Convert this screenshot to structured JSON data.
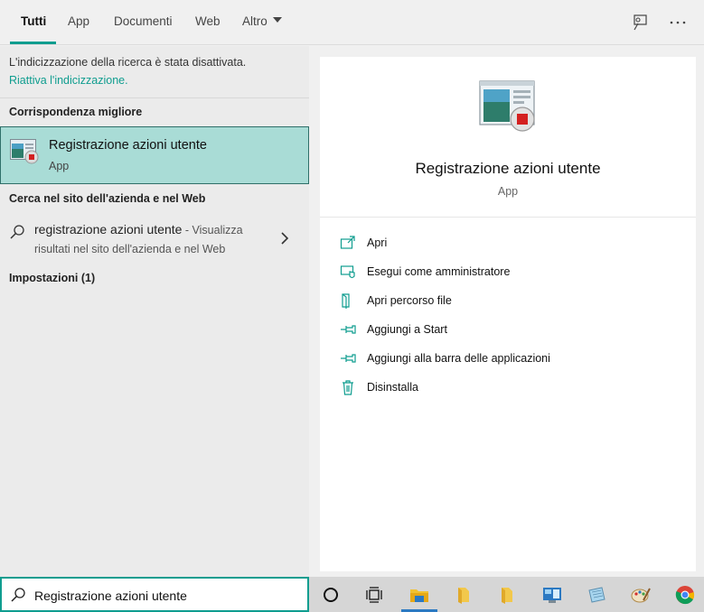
{
  "tabs": [
    {
      "label": "Tutti"
    },
    {
      "label": "App"
    },
    {
      "label": "Documenti"
    },
    {
      "label": "Web"
    },
    {
      "label": "Altro"
    }
  ],
  "top_icons": {
    "feedback": "feedback-icon",
    "more": "more-options-icon"
  },
  "left": {
    "notice": "L'indicizzazione della ricerca è stata disattivata.",
    "notice_link": "Riattiva l'indicizzazione.",
    "best_match_header": "Corrispondenza migliore",
    "best_match": {
      "title": "Registrazione azioni utente",
      "subtitle": "App"
    },
    "web_header": "Cerca nel sito dell'azienda e nel Web",
    "web_result": {
      "query": "registrazione azioni utente",
      "suffix": " - Visualizza",
      "line2": "risultati nel sito dell'azienda e nel Web"
    },
    "settings_header": "Impostazioni (1)"
  },
  "preview": {
    "title": "Registrazione azioni utente",
    "type": "App",
    "actions": [
      {
        "label": "Apri",
        "icon": "open-icon"
      },
      {
        "label": "Esegui come amministratore",
        "icon": "shield-admin-icon"
      },
      {
        "label": "Apri percorso file",
        "icon": "file-location-icon"
      },
      {
        "label": "Aggiungi a Start",
        "icon": "pin-icon"
      },
      {
        "label": "Aggiungi alla barra delle applicazioni",
        "icon": "pin-icon"
      },
      {
        "label": "Disinstalla",
        "icon": "trash-icon"
      }
    ]
  },
  "taskbar": {
    "search_value": "Registrazione azioni utente",
    "icons": [
      "cortana-icon",
      "task-view-icon",
      "file-explorer-icon",
      "folder-icon",
      "folder-icon",
      "control-panel-icon",
      "notepad-icon",
      "paint-icon",
      "chrome-icon"
    ]
  },
  "colors": {
    "accent": "#0f9d8f",
    "selection": "#a9dcd6"
  }
}
